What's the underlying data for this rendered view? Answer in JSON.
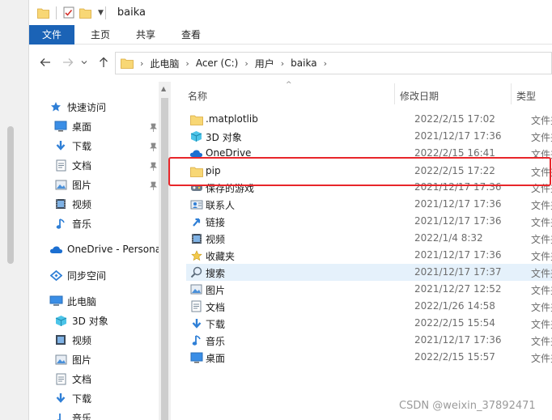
{
  "window": {
    "title": "baika"
  },
  "ribbon": {
    "tabs": [
      "文件",
      "主页",
      "共享",
      "查看"
    ]
  },
  "address": {
    "crumbs": [
      "此电脑",
      "Acer (C:)",
      "用户",
      "baika"
    ]
  },
  "nav": {
    "quick_access": "快速访问",
    "items_quick": [
      {
        "label": "桌面",
        "icon": "desktop-icon",
        "pinned": true
      },
      {
        "label": "下载",
        "icon": "download-icon",
        "pinned": true
      },
      {
        "label": "文档",
        "icon": "document-icon",
        "pinned": true
      },
      {
        "label": "图片",
        "icon": "picture-icon",
        "pinned": true
      },
      {
        "label": "视频",
        "icon": "video-icon",
        "pinned": false
      },
      {
        "label": "音乐",
        "icon": "music-icon",
        "pinned": false
      }
    ],
    "onedrive": "OneDrive - Persona",
    "sync": "同步空间",
    "this_pc": "此电脑",
    "items_pc": [
      {
        "label": "3D 对象",
        "icon": "3d-objects-icon"
      },
      {
        "label": "视频",
        "icon": "video-icon"
      },
      {
        "label": "图片",
        "icon": "picture-icon"
      },
      {
        "label": "文档",
        "icon": "document-icon"
      },
      {
        "label": "下载",
        "icon": "download-icon"
      },
      {
        "label": "音乐",
        "icon": "music-icon"
      }
    ]
  },
  "list": {
    "columns": {
      "name": "名称",
      "modified": "修改日期",
      "type": "类型"
    },
    "rows": [
      {
        "name": ".matplotlib",
        "date": "2022/2/15 17:02",
        "type": "文件夹",
        "icon": "folder-icon"
      },
      {
        "name": "3D 对象",
        "date": "2021/12/17 17:36",
        "type": "文件夹",
        "icon": "3d-objects-icon"
      },
      {
        "name": "OneDrive",
        "date": "2022/2/15 16:41",
        "type": "文件夹",
        "icon": "onedrive-icon"
      },
      {
        "name": "pip",
        "date": "2022/2/15 17:22",
        "type": "文件夹",
        "icon": "folder-icon"
      },
      {
        "name": "保存的游戏",
        "date": "2021/12/17 17:36",
        "type": "文件夹",
        "icon": "saved-games-icon"
      },
      {
        "name": "联系人",
        "date": "2021/12/17 17:36",
        "type": "文件夹",
        "icon": "contacts-icon"
      },
      {
        "name": "链接",
        "date": "2021/12/17 17:36",
        "type": "文件夹",
        "icon": "links-icon"
      },
      {
        "name": "视频",
        "date": "2022/1/4 8:32",
        "type": "文件夹",
        "icon": "video-icon"
      },
      {
        "name": "收藏夹",
        "date": "2021/12/17 17:36",
        "type": "文件夹",
        "icon": "favorites-icon"
      },
      {
        "name": "搜索",
        "date": "2021/12/17 17:37",
        "type": "文件夹",
        "icon": "search-icon"
      },
      {
        "name": "图片",
        "date": "2021/12/27 12:52",
        "type": "文件夹",
        "icon": "picture-icon"
      },
      {
        "name": "文档",
        "date": "2022/1/26 14:58",
        "type": "文件夹",
        "icon": "document-icon"
      },
      {
        "name": "下载",
        "date": "2022/2/15 15:54",
        "type": "文件夹",
        "icon": "download-icon"
      },
      {
        "name": "音乐",
        "date": "2021/12/17 17:36",
        "type": "文件夹",
        "icon": "music-icon"
      },
      {
        "name": "桌面",
        "date": "2022/2/15 15:57",
        "type": "文件夹",
        "icon": "desktop-icon"
      }
    ]
  },
  "watermark": "CSDN @weixin_37892471",
  "colors": {
    "accent": "#1b63b6",
    "highlight": "#e8262a",
    "selected_row": "#e5f1fb"
  }
}
